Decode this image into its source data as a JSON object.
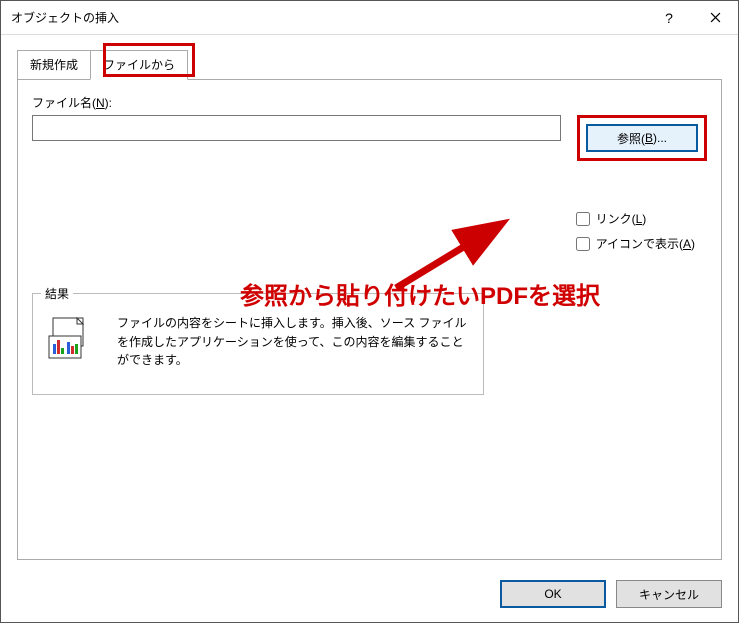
{
  "window": {
    "title": "オブジェクトの挿入",
    "help": "?",
    "close": "×"
  },
  "tabs": {
    "createNew": "新規作成",
    "fromFile": "ファイルから"
  },
  "file": {
    "label_pre": "ファイル名(",
    "label_u": "N",
    "label_post": "):",
    "value": "",
    "browse_pre": "参照(",
    "browse_u": "B",
    "browse_post": ")..."
  },
  "checks": {
    "link_pre": "リンク(",
    "link_u": "L",
    "link_post": ")",
    "icon_pre": "アイコンで表示(",
    "icon_u": "A",
    "icon_post": ")"
  },
  "result": {
    "title": "結果",
    "text": "ファイルの内容をシートに挿入します。挿入後、ソース ファイルを作成したアプリケーションを使って、この内容を編集することができます。"
  },
  "buttons": {
    "ok": "OK",
    "cancel": "キャンセル"
  },
  "annotation": {
    "text": "参照から貼り付けたいPDFを選択"
  }
}
